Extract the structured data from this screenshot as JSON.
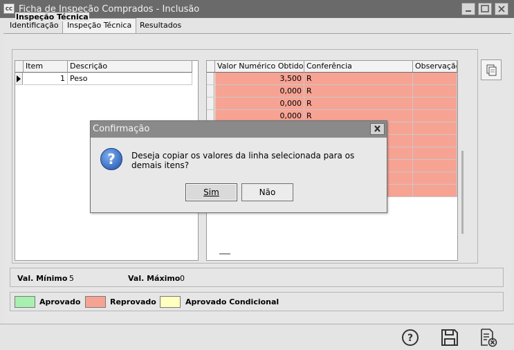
{
  "window": {
    "app_icon": "CC",
    "title": "Ficha de Inspeção Comprados - Inclusão",
    "minimize_icon": "minimize-icon",
    "maximize_icon": "maximize-icon",
    "close_icon": "close-icon"
  },
  "tabs": [
    {
      "label": "Identificação",
      "active": false
    },
    {
      "label": "Inspeção Técnica",
      "active": true
    },
    {
      "label": "Resultados",
      "active": false
    }
  ],
  "group": {
    "title": "Inspeção Técnica"
  },
  "left_grid": {
    "columns": [
      "Item",
      "Descrição"
    ],
    "rows": [
      {
        "item": "1",
        "descricao": "Peso"
      }
    ]
  },
  "right_grid": {
    "columns": [
      "Valor Numérico Obtido",
      "Conferência",
      "Observação"
    ],
    "rows": [
      {
        "valor": "3,500",
        "conferencia": "R",
        "observacao": ""
      },
      {
        "valor": "0,000",
        "conferencia": "R",
        "observacao": ""
      },
      {
        "valor": "0,000",
        "conferencia": "R",
        "observacao": ""
      },
      {
        "valor": "0,000",
        "conferencia": "R",
        "observacao": ""
      },
      {
        "valor": "",
        "conferencia": "",
        "observacao": ""
      },
      {
        "valor": "",
        "conferencia": "",
        "observacao": ""
      },
      {
        "valor": "",
        "conferencia": "",
        "observacao": ""
      },
      {
        "valor": "",
        "conferencia": "",
        "observacao": ""
      },
      {
        "valor": "",
        "conferencia": "",
        "observacao": ""
      },
      {
        "valor": "",
        "conferencia": "",
        "observacao": ""
      }
    ]
  },
  "limits": {
    "min_label": "Val. Mínimo",
    "min_value": "5",
    "max_label": "Val. Máximo",
    "max_value": "0"
  },
  "legend": [
    {
      "label": "Aprovado",
      "color": "#a8f0b0"
    },
    {
      "label": "Reprovado",
      "color": "#f7a394"
    },
    {
      "label": "Aprovado Condicional",
      "color": "#ffffc0"
    }
  ],
  "colors": {
    "row_reprovado": "#f7a394"
  },
  "dialog": {
    "title": "Confirmação",
    "icon": "question-icon",
    "message": "Deseja copiar os valores da linha selecionada para os demais itens?",
    "yes_label": "Sim",
    "no_label": "Não"
  },
  "toolbar": {
    "help_icon": "help-icon",
    "save_icon": "save-icon",
    "cancel_icon": "cancel-document-icon"
  }
}
